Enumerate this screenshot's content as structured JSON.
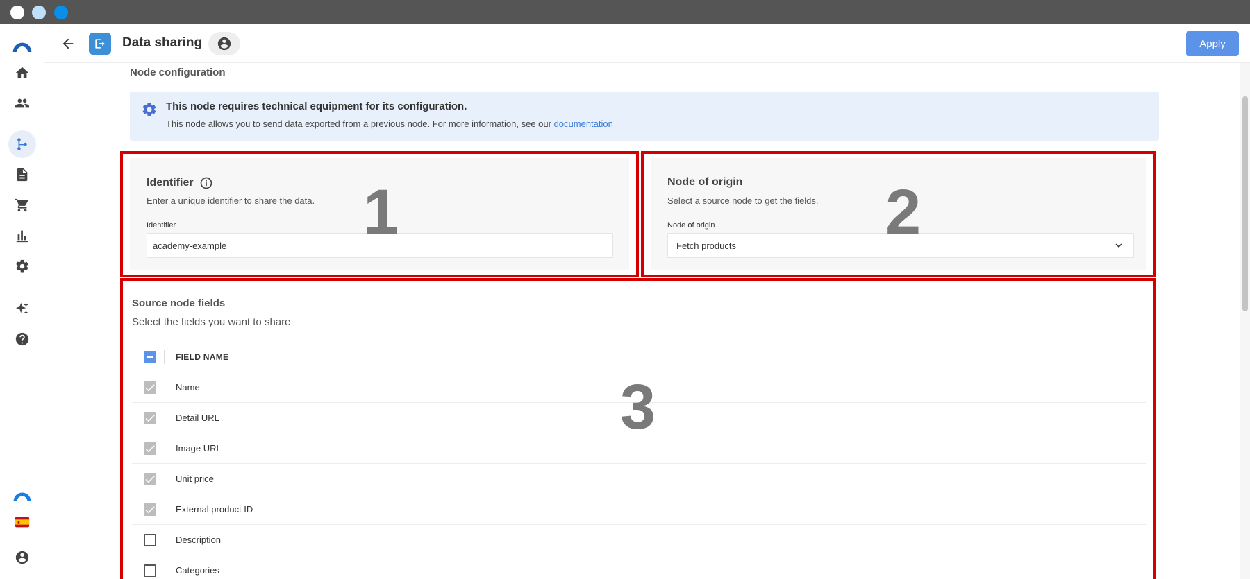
{
  "header": {
    "page_title": "Data sharing",
    "apply_label": "Apply"
  },
  "sidebar": {
    "items": [
      {
        "icon": "logo-icon"
      },
      {
        "icon": "home-icon"
      },
      {
        "icon": "users-icon"
      },
      {
        "icon": "flow-icon",
        "active": true
      },
      {
        "icon": "document-icon"
      },
      {
        "icon": "cart-icon"
      },
      {
        "icon": "chart-icon"
      },
      {
        "icon": "gear-icon"
      },
      {
        "icon": "sparkle-icon"
      },
      {
        "icon": "help-icon"
      },
      {
        "icon": "brand-icon"
      },
      {
        "icon": "spain-flag-icon"
      },
      {
        "icon": "account-icon"
      }
    ]
  },
  "main": {
    "section_title": "Node configuration",
    "banner": {
      "heading": "This node requires technical equipment for its configuration.",
      "text": "This node allows you to send data exported from a previous node. For more information, see our ",
      "link": "documentation"
    },
    "panel_numbers": [
      "1",
      "2",
      "3"
    ],
    "identifier_card": {
      "title": "Identifier",
      "description": "Enter a unique identifier to share the data.",
      "field_label": "Identifier",
      "value": "academy-example"
    },
    "origin_card": {
      "title": "Node of origin",
      "description": "Select a source node to get the fields.",
      "field_label": "Node of origin",
      "selected": "Fetch products"
    },
    "fields": {
      "title": "Source node fields",
      "description": "Select the fields you want to share",
      "column_header": "FIELD NAME",
      "rows": [
        {
          "label": "Name",
          "checked": true
        },
        {
          "label": "Detail URL",
          "checked": true
        },
        {
          "label": "Image URL",
          "checked": true
        },
        {
          "label": "Unit price",
          "checked": true
        },
        {
          "label": "External product ID",
          "checked": true
        },
        {
          "label": "Description",
          "checked": false
        },
        {
          "label": "Categories",
          "checked": false
        }
      ]
    }
  },
  "colors": {
    "accent": "#5b93e8",
    "highlight_border": "#d40000",
    "banner_bg": "#e8f1fb"
  }
}
